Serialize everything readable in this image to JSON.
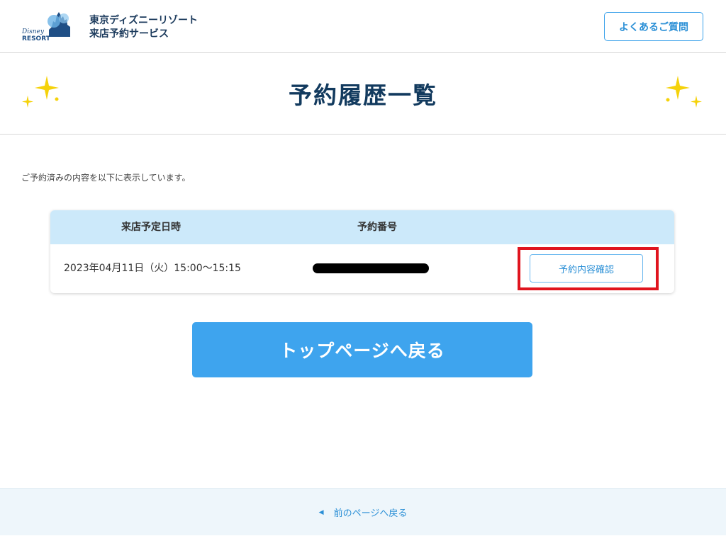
{
  "header": {
    "logo_text": "Disney RESORT",
    "brand_line1": "東京ディズニーリゾート",
    "brand_line2": "来店予約サービス",
    "faq_label": "よくあるご質問"
  },
  "page": {
    "title": "予約履歴一覧",
    "intro": "ご予約済みの内容を以下に表示しています。"
  },
  "table": {
    "headers": [
      "来店予定日時",
      "予約番号"
    ],
    "rows": [
      {
        "datetime": "2023年04月11日（火）15:00〜15:15",
        "reservation_number": "[redacted]",
        "action_label": "予約内容確認"
      }
    ]
  },
  "top_button_label": "トップページへ戻る",
  "footer": {
    "back_label": "前のページへ戻る"
  },
  "colors": {
    "accent": "#3ea4ee",
    "title": "#123a5e",
    "table_header": "#cce9fa",
    "highlight": "#e0141e",
    "sparkle": "#f5d20a"
  }
}
